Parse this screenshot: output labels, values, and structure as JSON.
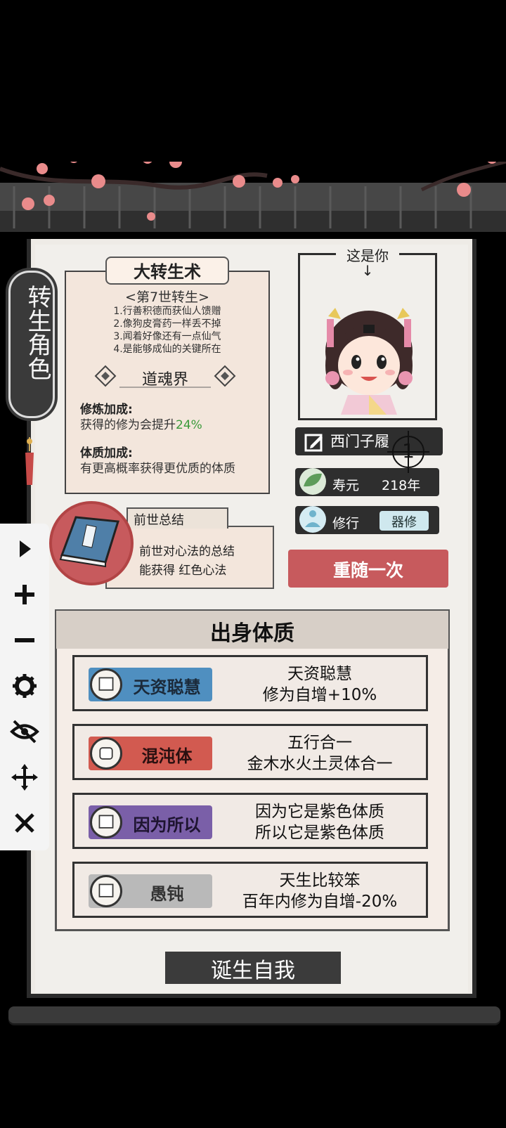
{
  "side_tab": {
    "label": "转生角色"
  },
  "art": {
    "title": "大转生术",
    "generation": "<第7世转生>",
    "lines": [
      "1.行善积德而获仙人馈赠",
      "2.像狗皮膏药一样丢不掉",
      "3.闻着好像还有一点仙气",
      "4.是能够成仙的关键所在"
    ],
    "realm": "道魂界",
    "cultivation_bonus_title": "修炼加成:",
    "cultivation_bonus_prefix": "获得的修为会提升",
    "cultivation_bonus_value": "24%",
    "physique_bonus_title": "体质加成:",
    "physique_bonus_text": "有更高概率获得更优质的体质"
  },
  "portrait": {
    "label": "这是你",
    "arrow": "↓"
  },
  "character": {
    "name": "西门子履",
    "lifespan_label": "寿元",
    "lifespan_value": "218年",
    "practice_label": "修行",
    "practice_value": "器修",
    "reroll_label": "重随一次"
  },
  "past_life": {
    "title": "前世总结",
    "line1": "前世对心法的总结",
    "line2": "能获得 红色心法"
  },
  "constitution": {
    "title": "出身体质",
    "rows": [
      {
        "badge": "天资聪慧",
        "color": "#4f8fc0",
        "icon": "scroll-icon",
        "desc1": "天资聪慧",
        "desc2": "修为自增+10%"
      },
      {
        "badge": "混沌体",
        "color": "#d25a50",
        "icon": "fist-icon",
        "desc1": "五行合一",
        "desc2": "金木水火土灵体合一"
      },
      {
        "badge": "因为所以",
        "color": "#7a5fa8",
        "icon": "scroll-icon",
        "desc1": "因为它是紫色体质",
        "desc2": "所以它是紫色体质"
      },
      {
        "badge": "愚钝",
        "color": "#b9b9b9",
        "icon": "scroll-icon",
        "desc1": "天生比较笨",
        "desc2": "百年内修为自增-20%"
      }
    ]
  },
  "birth_button": {
    "label": "诞生自我"
  },
  "toolbar": {
    "items": [
      "play-icon",
      "plus-icon",
      "minus-icon",
      "gear-icon",
      "eye-off-icon",
      "move-icon",
      "close-icon"
    ]
  },
  "crosshair": {
    "number": "1"
  }
}
